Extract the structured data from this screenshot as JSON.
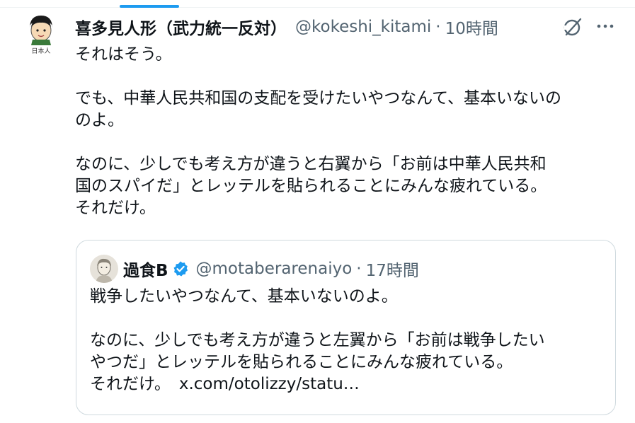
{
  "tweet": {
    "display_name": "喜多見人形（武力統一反対）",
    "handle": "@kokeshi_kitami",
    "separator": "·",
    "time": "10時間",
    "avatar_caption": "日本人",
    "lines": [
      "それはそう。",
      "",
      "でも、中華人民共和国の支配を受けたいやつなんて、基本いないの",
      "のよ。",
      "",
      "なのに、少しでも考え方が違うと右翼から「お前は中華人民共和",
      "国のスパイだ」とレッテルを貼られることにみんな疲れている。",
      "それだけ。"
    ]
  },
  "quote": {
    "display_name": "過食B",
    "handle": "@motaberarenaiyo",
    "separator": "·",
    "time": "17時間",
    "lines": [
      "戦争したいやつなんて、基本いないのよ。",
      "",
      "なのに、少しでも考え方が違うと左翼から「お前は戦争したい",
      "やつだ」とレッテルを貼られることにみんな疲れている。"
    ],
    "last_line_text": "それだけ。",
    "link": "x.com/otolizzy/statu…"
  },
  "icons": {
    "grok": "grok-icon",
    "more": "more-icon",
    "verified": "verified-badge-icon"
  },
  "colors": {
    "accent": "#1d9bf0",
    "text": "#0f1419",
    "muted": "#536471",
    "border": "#cfd9de"
  }
}
